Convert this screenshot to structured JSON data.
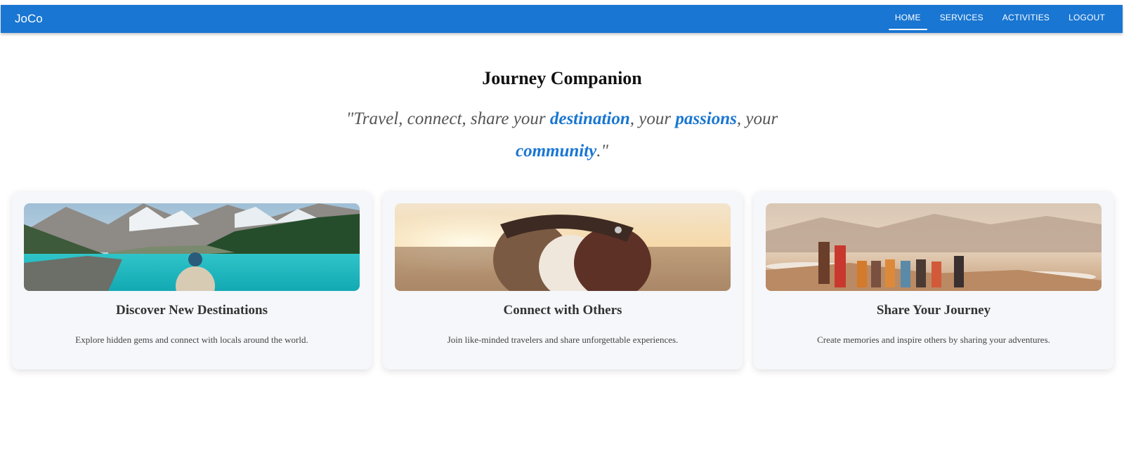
{
  "header": {
    "brand": "JoCo",
    "nav": [
      {
        "label": "HOME",
        "active": true
      },
      {
        "label": "SERVICES",
        "active": false
      },
      {
        "label": "ACTIVITIES",
        "active": false
      },
      {
        "label": "LOGOUT",
        "active": false
      }
    ],
    "color": "#1976d2"
  },
  "hero": {
    "title": "Journey Companion",
    "tagline": {
      "open": "\"Travel, connect, share your ",
      "w1": "destination",
      "sep1": ", your ",
      "w2": "passions",
      "sep2": ", your ",
      "w3": "community",
      "close": ".\""
    }
  },
  "cards": [
    {
      "title": "Discover New Destinations",
      "description": "Explore hidden gems and connect with locals around the world.",
      "image": "mountain-lake-photo"
    },
    {
      "title": "Connect with Others",
      "description": "Join like-minded travelers and share unforgettable experiences.",
      "image": "beach-group-hug-photo"
    },
    {
      "title": "Share Your Journey",
      "description": "Create memories and inspire others by sharing your adventures.",
      "image": "celebrating-hikers-photo"
    }
  ]
}
